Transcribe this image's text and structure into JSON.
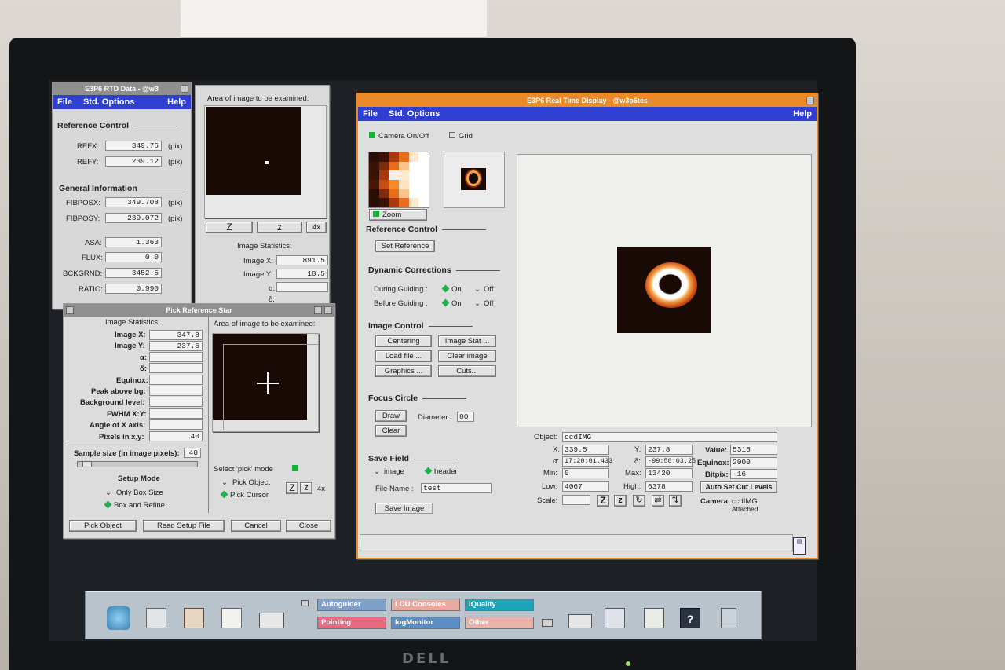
{
  "rtd": {
    "title": "E3P6 RTD Data - @w3",
    "menu": {
      "file": "File",
      "options": "Std. Options",
      "help": "Help"
    },
    "ref_header": "Reference Control",
    "refx_label": "REFX:",
    "refx": "349.76",
    "refx_unit": "(pix)",
    "refy_label": "REFY:",
    "refy": "239.12",
    "refy_unit": "(pix)",
    "gen_header": "General Information",
    "fibposx_label": "FIBPOSX:",
    "fibposx": "349.708",
    "fibposx_unit": "(pix)",
    "fibposy_label": "FIBPOSY:",
    "fibposy": "239.072",
    "fibposy_unit": "(pix)",
    "asa_label": "ASA:",
    "asa": "1.363",
    "flux_label": "FLUX:",
    "flux": "0.0",
    "bckgrnd_label": "BCKGRND:",
    "bckgrnd": "3452.5",
    "ratio_label": "RATIO:",
    "ratio": "0.990"
  },
  "examine": {
    "heading": "Area of image to be examined:",
    "btn_zoom_in": "Z",
    "btn_zoom_out": "z",
    "btn_scale": "4x",
    "stats_heading": "Image Statistics:",
    "imgx_label": "Image X:",
    "imgx": "891.5",
    "imgy_label": "Image Y:",
    "imgy": "18.5",
    "alpha_label": "α:",
    "delta_label": "δ:"
  },
  "pick": {
    "title": "Pick Reference Star",
    "stats_heading": "Image Statistics:",
    "examine_heading": "Area of image to be examined:",
    "imgx_label": "Image X:",
    "imgx": "347.8",
    "imgy_label": "Image Y:",
    "imgy": "237.5",
    "alpha_label": "α:",
    "delta_label": "δ:",
    "equinox_label": "Equinox:",
    "peak_label": "Peak above bg:",
    "bg_label": "Background level:",
    "fwhm_label": "FWHM X:Y:",
    "angle_label": "Angle of X axis:",
    "pixels_label": "Pixels in x,y:",
    "pixels": "40",
    "sample_label": "Sample size (in image pixels):",
    "sample": "40",
    "setup_label": "Setup Mode",
    "only_box": "Only Box Size",
    "box_refine": "Box and Refine.",
    "select_mode": "Select 'pick' mode",
    "pick_object": "Pick Object",
    "pick_cursor": "Pick Cursor",
    "btn_zoom_in": "Z",
    "btn_zoom_out": "z",
    "btn_scale": "4x",
    "btn_pick": "Pick Object",
    "btn_read": "Read Setup File",
    "btn_cancel": "Cancel",
    "btn_close": "Close"
  },
  "rtdisplay": {
    "title": "E3P6 Real Time Display - @w3p6tcs",
    "menu": {
      "file": "File",
      "options": "Std. Options",
      "help": "Help"
    },
    "camera_label": "Camera On/Off",
    "grid_label": "Grid",
    "zoom_label": "Zoom",
    "ref_header": "Reference Control",
    "set_ref": "Set Reference",
    "dyn_header": "Dynamic Corrections",
    "during_label": "During Guiding :",
    "before_label": "Before Guiding :",
    "on": "On",
    "off": "Off",
    "img_ctrl_header": "Image Control",
    "btn_centering": "Centering",
    "btn_imgstat": "Image Stat ...",
    "btn_load": "Load file ...",
    "btn_clear_img": "Clear image",
    "btn_graphics": "Graphics ...",
    "btn_cuts": "Cuts...",
    "focus_header": "Focus Circle",
    "btn_draw": "Draw",
    "btn_clear": "Clear",
    "diameter_label": "Diameter :",
    "diameter": "80",
    "save_header": "Save Field",
    "opt_image": "image",
    "opt_header": "header",
    "filename_label": "File Name :",
    "filename": "test",
    "btn_save": "Save Image",
    "info": {
      "object_label": "Object:",
      "object": "ccdIMG",
      "x_label": "X:",
      "x": "339.5",
      "y_label": "Y:",
      "y": "237.8",
      "value_label": "Value:",
      "value": "5316",
      "alpha_label": "α:",
      "alpha": "17:20:01.433",
      "delta_label": "δ:",
      "delta": "-99:50:03.25",
      "equinox_label": "Equinox:",
      "equinox": "2000",
      "min_label": "Min:",
      "min": "0",
      "max_label": "Max:",
      "max": "13420",
      "bitpix_label": "Bitpix:",
      "bitpix": "-16",
      "low_label": "Low:",
      "low": "4067",
      "high_label": "High:",
      "high": "6378",
      "auto_cut": "Auto Set Cut Levels",
      "scale_label": "Scale:",
      "camera_label": "Camera:",
      "camera": "ccdIMG",
      "attached": "Attached"
    }
  },
  "taskbar": {
    "tiles": [
      {
        "label": "Autoguider",
        "color": "#7ea0c9"
      },
      {
        "label": "LCU Consoles",
        "color": "#e8a9a0"
      },
      {
        "label": "IQuality",
        "color": "#1fa3b8"
      },
      {
        "label": "Pointing",
        "color": "#e86a7e"
      },
      {
        "label": "logMonitor",
        "color": "#5b8ec4"
      },
      {
        "label": "Other",
        "color": "#e8b3a8"
      }
    ]
  },
  "monitor": {
    "brand": "DELL"
  }
}
